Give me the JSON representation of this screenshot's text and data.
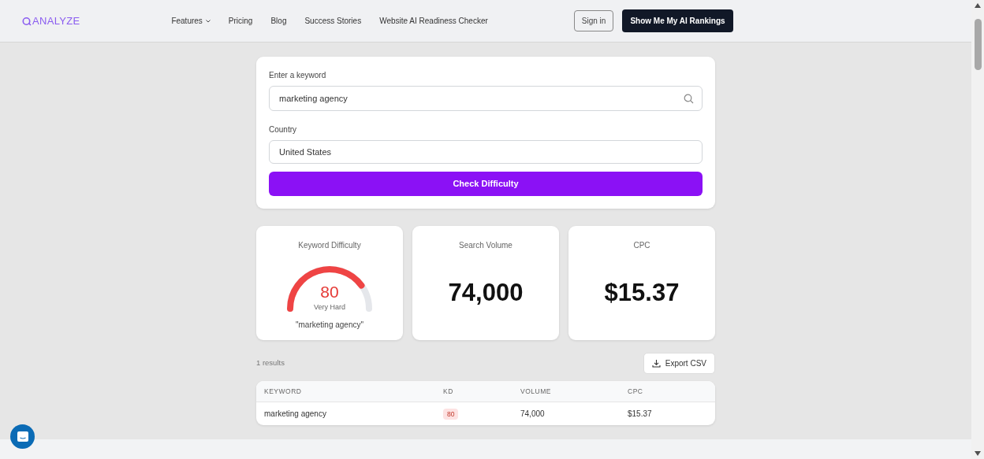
{
  "navbar": {
    "logo": "ANALYZE",
    "links": [
      {
        "label": "Features",
        "dropdown": true
      },
      {
        "label": "Pricing",
        "dropdown": false
      },
      {
        "label": "Blog",
        "dropdown": false
      },
      {
        "label": "Success Stories",
        "dropdown": false
      },
      {
        "label": "Website AI Readiness Checker",
        "dropdown": false
      }
    ],
    "sign_in": "Sign in",
    "cta": "Show Me My AI Rankings"
  },
  "form": {
    "keyword_label": "Enter a keyword",
    "keyword_value": "marketing agency",
    "country_label": "Country",
    "country_value": "United States",
    "submit": "Check Difficulty"
  },
  "stats": [
    {
      "kind": "gauge",
      "title": "Keyword Difficulty",
      "value": "80",
      "rating": "Very Hard",
      "keyword": "\"marketing agency\""
    },
    {
      "kind": "number",
      "title": "Search Volume",
      "value": "74,000"
    },
    {
      "kind": "number",
      "title": "CPC",
      "value": "$15.37"
    }
  ],
  "results": {
    "count": "1 results",
    "export": "Export CSV",
    "columns": [
      "KEYWORD",
      "KD",
      "VOLUME",
      "CPC"
    ],
    "rows": [
      {
        "keyword": "marketing agency",
        "kd": "80",
        "volume": "74,000",
        "cpc": "$15.37"
      }
    ]
  }
}
